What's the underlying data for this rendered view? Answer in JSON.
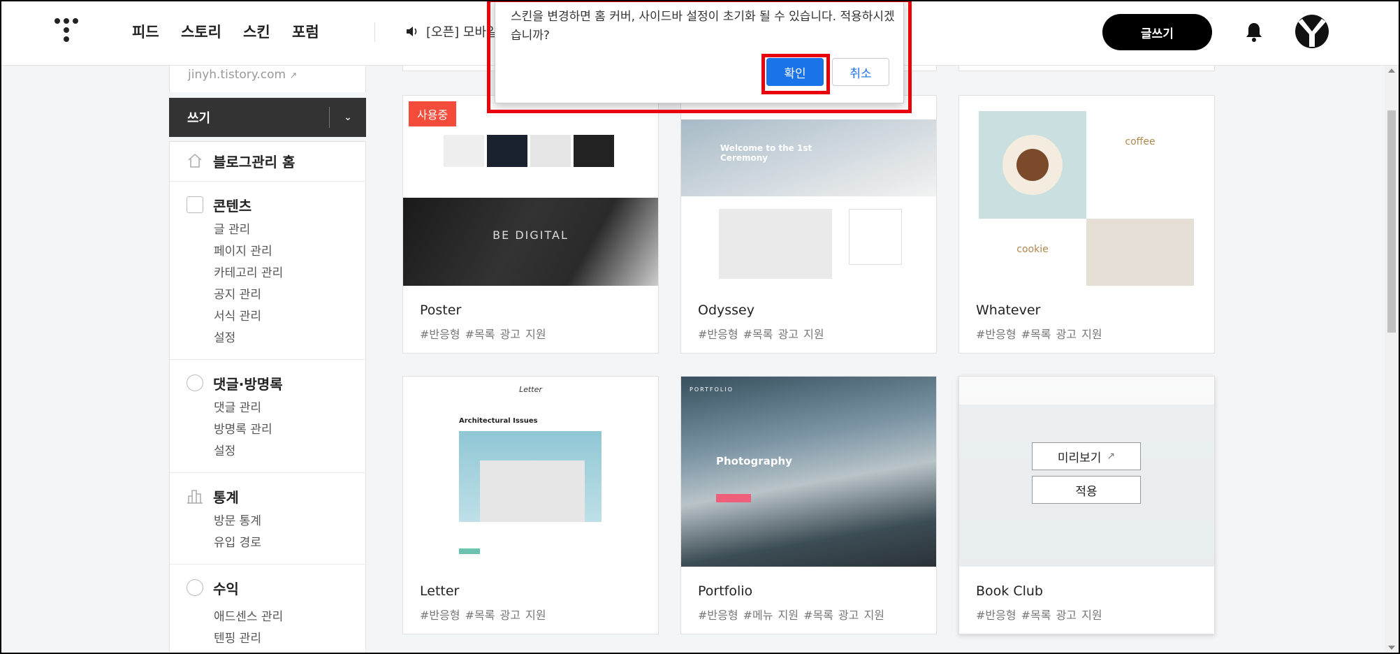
{
  "header": {
    "nav": [
      "피드",
      "스토리",
      "스킨",
      "포럼"
    ],
    "notice": "[오픈] 모바일",
    "write_button": "글쓰기"
  },
  "sidebar": {
    "blog_url": "jinyh.tistory.com",
    "write_label": "쓰기",
    "sections": [
      {
        "title": "블로그관리 홈",
        "items": []
      },
      {
        "title": "콘텐츠",
        "items": [
          "글 관리",
          "페이지 관리",
          "카테고리 관리",
          "공지 관리",
          "서식 관리",
          "설정"
        ]
      },
      {
        "title": "댓글·방명록",
        "items": [
          "댓글 관리",
          "방명록 관리",
          "설정"
        ]
      },
      {
        "title": "통계",
        "items": [
          "방문 통계",
          "유입 경로"
        ]
      },
      {
        "title": "수익",
        "items": [
          "애드센스 관리",
          "텐핑 관리"
        ]
      }
    ]
  },
  "skins": [
    {
      "name": "Poster",
      "tags": "#반응형 #목록 광고 지원",
      "badge": "사용중",
      "thumb_text": "BE DIGITAL"
    },
    {
      "name": "Odyssey",
      "tags": "#반응형 #목록 광고 지원",
      "thumb_text": "Welcome to the 1st Ceremony"
    },
    {
      "name": "Whatever",
      "tags": "#반응형 #목록 광고 지원",
      "thumb_text": "coffee",
      "thumb_text2": "cookie"
    },
    {
      "name": "Letter",
      "tags": "#반응형 #목록 광고 지원",
      "thumb_text": "Architectural Issues",
      "thumb_logo": "Letter"
    },
    {
      "name": "Portfolio",
      "tags": "#반응형 #메뉴 지원 #목록 광고 지원",
      "thumb_text": "Photography",
      "thumb_logo": "PORTFOLIO"
    },
    {
      "name": "Book Club",
      "tags": "#반응형 #목록 광고 지원",
      "preview_label": "미리보기",
      "apply_label": "적용"
    }
  ],
  "dialog": {
    "message": "스킨을 변경하면 홈 커버, 사이드바 설정이 초기화 될 수 있습니다. 적용하시겠습니까?",
    "ok_label": "확인",
    "cancel_label": "취소"
  },
  "colors": {
    "accent": "#1a73e8",
    "badge": "#f44c3a",
    "highlight": "#e8000b"
  }
}
